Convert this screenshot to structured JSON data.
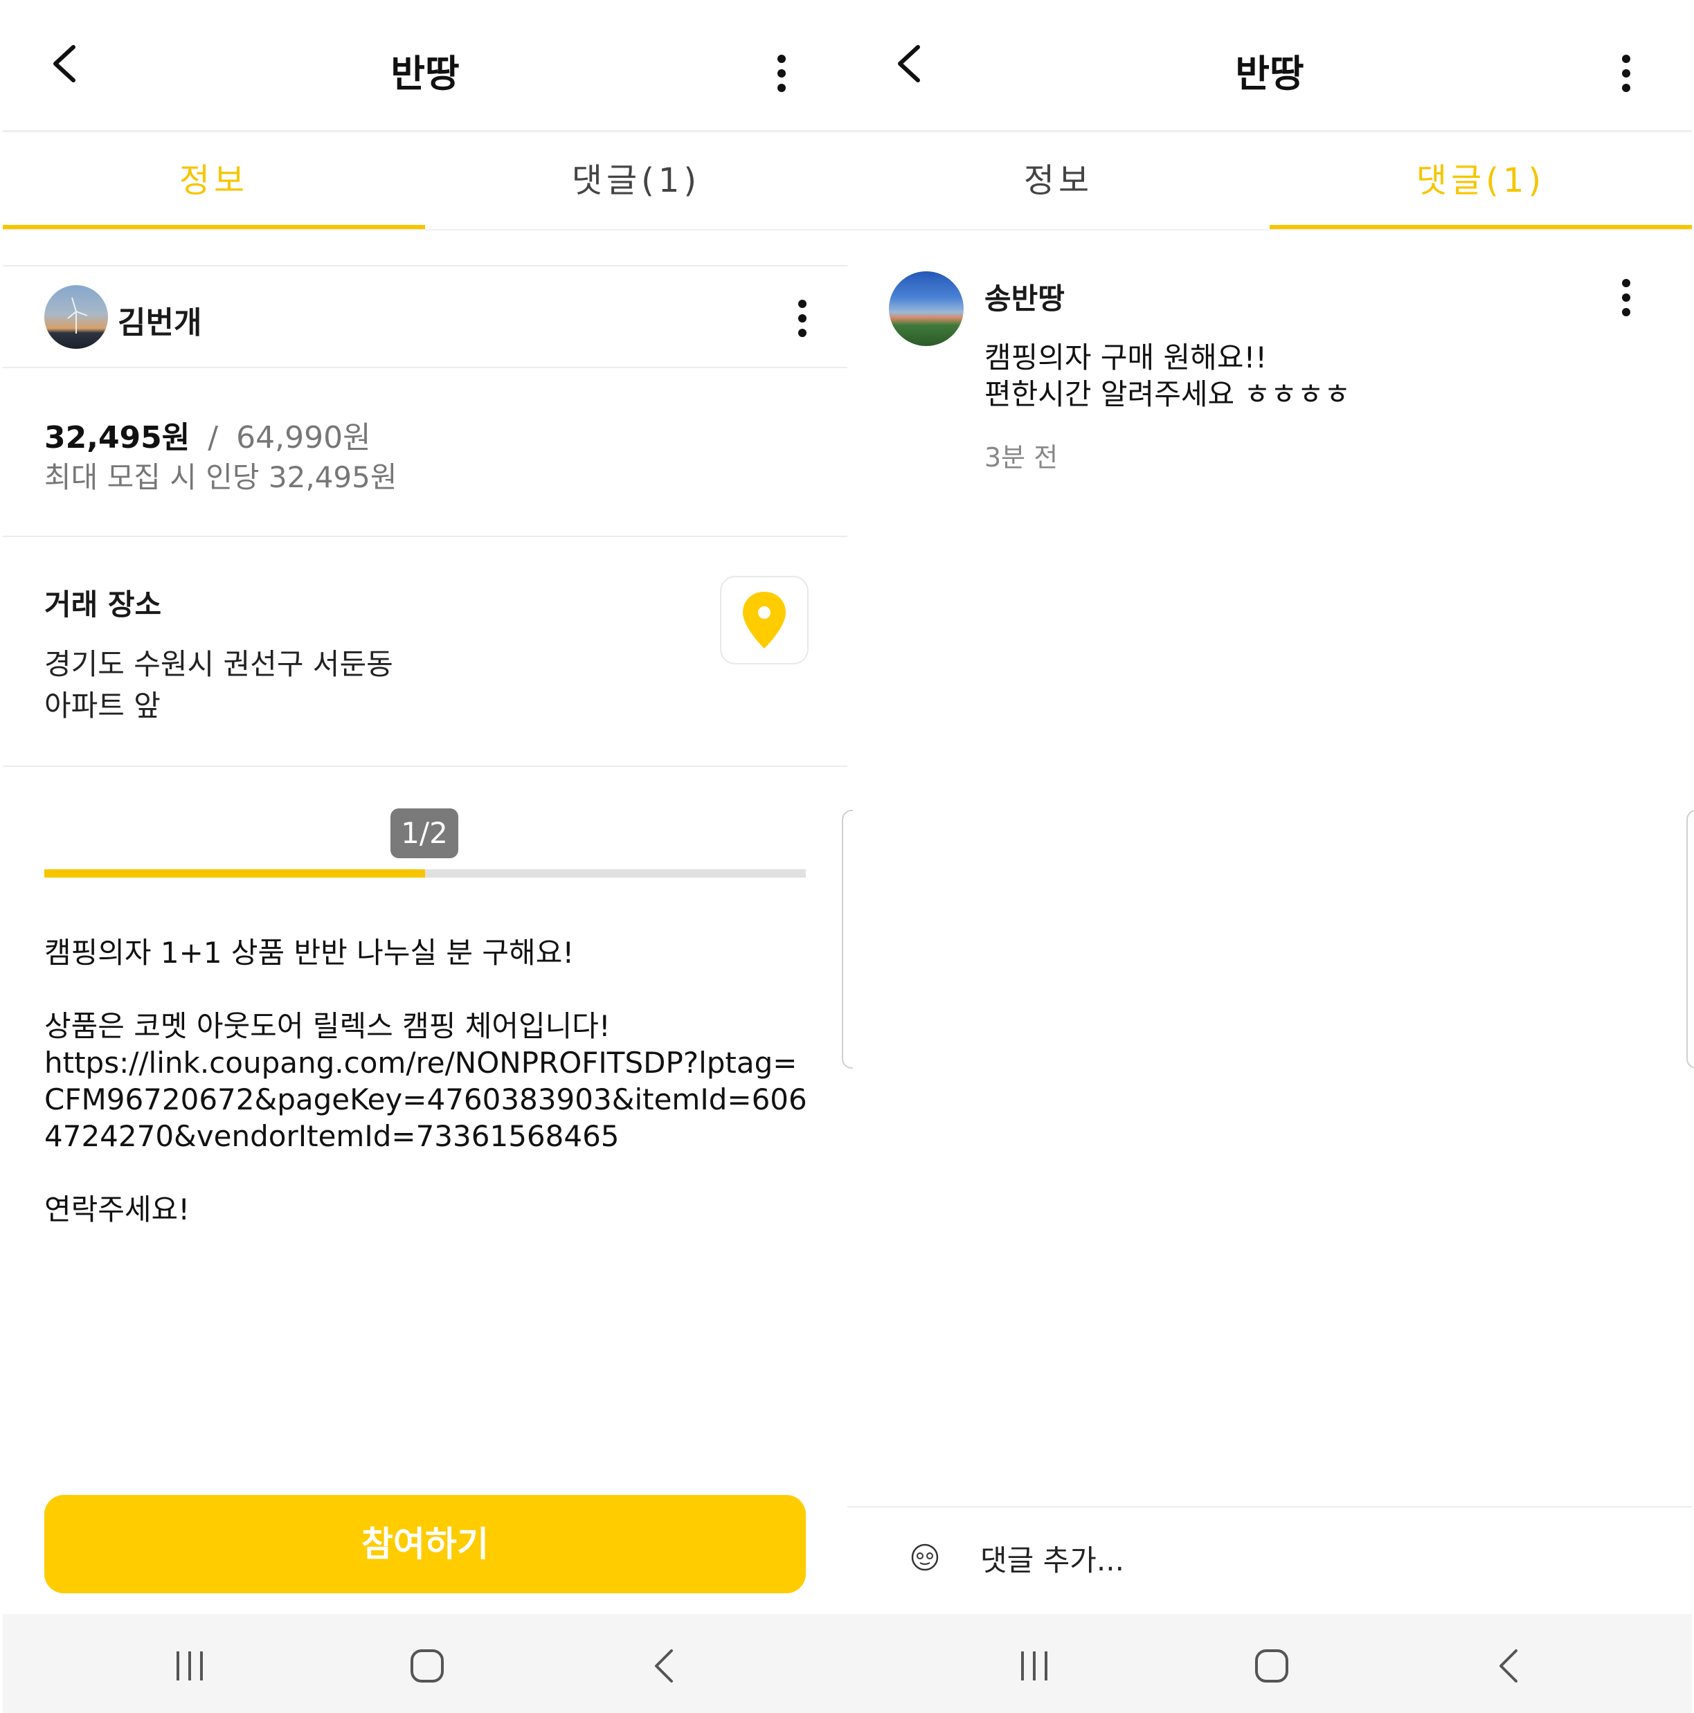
{
  "left": {
    "header": {
      "title": "반땅"
    },
    "tabs": [
      {
        "label": "정보"
      },
      {
        "label": "댓글(1)"
      }
    ],
    "seller": {
      "name": "김번개"
    },
    "price": {
      "share": "32,495원",
      "separator": "/",
      "total": "64,990원",
      "per_person": "최대 모집 시 인당 32,495원"
    },
    "location": {
      "heading": "거래 장소",
      "address_line1": "경기도 수원시 권선구 서둔동",
      "address_line2": "아파트 앞"
    },
    "progress": {
      "label": "1/2",
      "fraction": 0.5
    },
    "body": {
      "line1": "캠핑의자 1+1 상품 반반 나누실 분 구해요!",
      "line2": "상품은 코멧 아웃도어 릴렉스 캠핑 체어입니다!",
      "link": "https://link.coupang.com/re/NONPROFITSDP?lptag=CFM96720672&pageKey=4760383903&itemId=6064724270&vendorItemId=73361568465",
      "line3": "연락주세요!"
    },
    "join_button": "참여하기"
  },
  "right": {
    "header": {
      "title": "반땅"
    },
    "tabs": [
      {
        "label": "정보"
      },
      {
        "label": "댓글(1)"
      }
    ],
    "comment": {
      "author": "송반땅",
      "line1": "캠핑의자 구매 원해요!!",
      "line2": "편한시간 알려주세요 ㅎㅎㅎㅎ",
      "time": "3분 전"
    },
    "comment_input": {
      "placeholder": "댓글 추가..."
    }
  },
  "colors": {
    "accent": "#ffcc00",
    "accent_text": "#f7c500",
    "badge": "#7a7a7a"
  },
  "icons": [
    "back-arrow-icon",
    "more-vert-icon",
    "location-pin-icon",
    "recent-apps-icon",
    "home-icon",
    "nav-back-icon",
    "user-face-icon"
  ]
}
